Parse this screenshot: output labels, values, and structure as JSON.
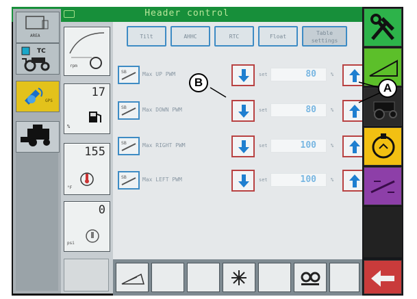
{
  "header": {
    "title": "Header control"
  },
  "left_buttons": [
    {
      "name": "area-icon",
      "label": "AREA"
    },
    {
      "name": "tractor-icon",
      "label": "TC"
    },
    {
      "name": "satellite-icon",
      "label": "GPS"
    },
    {
      "name": "combine-icon",
      "label": ""
    }
  ],
  "gauges": [
    {
      "name": "engine-speed-gauge",
      "value": "",
      "label": "rpm"
    },
    {
      "name": "fuel-gauge",
      "value": "17",
      "label": "%"
    },
    {
      "name": "coolant-temp-gauge",
      "value": "155",
      "label": "°F"
    },
    {
      "name": "oil-gauge",
      "value": "0",
      "label": "psi"
    }
  ],
  "tabs": [
    {
      "label": "Tilt",
      "active": false
    },
    {
      "label": "AHHC",
      "active": false
    },
    {
      "label": "RTC",
      "active": false
    },
    {
      "label": "Float",
      "active": false
    },
    {
      "label": "Table settings",
      "active": true
    }
  ],
  "rows": [
    {
      "label": "Max UP PWM",
      "set_label": "set",
      "value": "80",
      "unit": "%"
    },
    {
      "label": "Max DOWN PWM",
      "set_label": "set",
      "value": "80",
      "unit": "%"
    },
    {
      "label": "Max RIGHT PWM",
      "set_label": "set",
      "value": "100",
      "unit": "%"
    },
    {
      "label": "Max LEFT PWM",
      "set_label": "set",
      "value": "100",
      "unit": "%"
    }
  ],
  "right_buttons": [
    {
      "name": "tools-icon",
      "color": "#2db34a"
    },
    {
      "name": "ramp-icon",
      "color": "#5cbf2a"
    },
    {
      "name": "tractor-side-icon",
      "color": "#2a2a2a"
    },
    {
      "name": "engine-icon",
      "color": "#f2c012"
    },
    {
      "name": "slope-icon",
      "color": "#8d3fa8"
    },
    {
      "name": "exit-icon",
      "color": "#c93b3b"
    }
  ],
  "bottom_buttons": [
    {
      "name": "header-tilt-icon"
    },
    {
      "name": "blank-icon"
    },
    {
      "name": "blank-icon"
    },
    {
      "name": "sun-icon"
    },
    {
      "name": "blank-icon"
    },
    {
      "name": "dual-wheel-icon"
    },
    {
      "name": "blank-icon"
    },
    {
      "name": "blank-icon"
    }
  ],
  "callouts": {
    "a": "A",
    "b": "B"
  },
  "figure_id": "1026284",
  "colors": {
    "title_green": "#178f3a",
    "button_red": "#b84141",
    "arrow_blue": "#1f7fd0",
    "value_blue": "#79b7e2"
  }
}
